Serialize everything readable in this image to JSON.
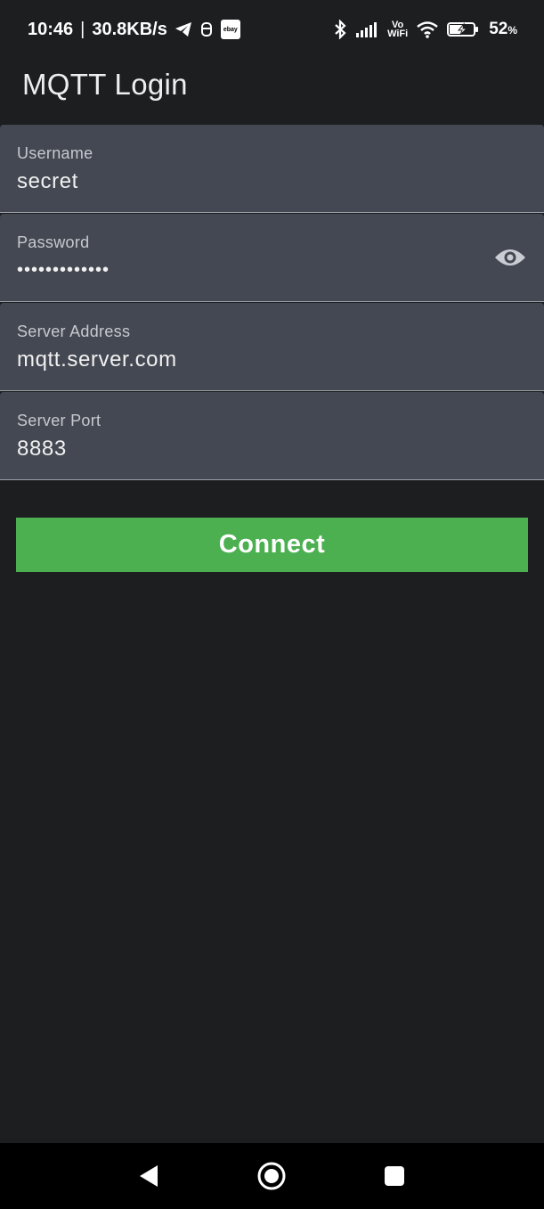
{
  "status_bar": {
    "time": "10:46",
    "separator": "|",
    "network_speed": "30.8KB/s",
    "ebay_label": "ebay",
    "vowifi_top": "Vo",
    "vowifi_bottom": "WiFi",
    "battery_percent": "52",
    "battery_unit": "%",
    "icons": [
      "telegram-icon",
      "notification-app-icon",
      "ebay-icon",
      "bluetooth-icon",
      "signal-icon",
      "vowifi-icon",
      "wifi-icon",
      "battery-charging-icon"
    ]
  },
  "app": {
    "title": "MQTT Login"
  },
  "form": {
    "username": {
      "label": "Username",
      "value": "secret"
    },
    "password": {
      "label": "Password",
      "value": "•••••••••••••"
    },
    "server_address": {
      "label": "Server Address",
      "value": "mqtt.server.com"
    },
    "server_port": {
      "label": "Server Port",
      "value": "8883"
    }
  },
  "actions": {
    "connect_label": "Connect"
  },
  "colors": {
    "background": "#1d1e20",
    "field_background": "#444852",
    "accent_button": "#4caf50"
  },
  "nav_bar": {
    "icons": [
      "back-icon",
      "home-icon",
      "recents-icon"
    ]
  }
}
